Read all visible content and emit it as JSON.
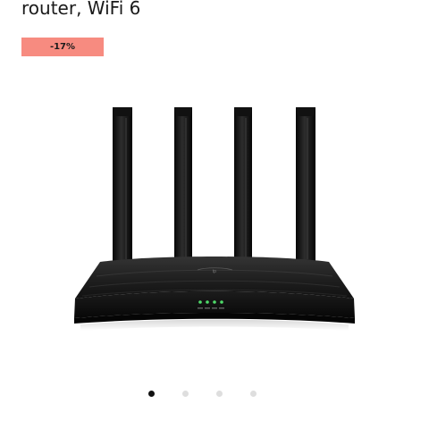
{
  "product": {
    "title": "router, WiFi 6",
    "discount_badge": "-17%",
    "image_alt": "router-image"
  },
  "carousel": {
    "total_slides": 4,
    "active_index": 0,
    "active_color": "#111111",
    "inactive_color": "#dedede"
  },
  "colors": {
    "badge_background": "#f78b80",
    "router_body": "#1b1b1b",
    "status_led": "#4fdc6a"
  }
}
